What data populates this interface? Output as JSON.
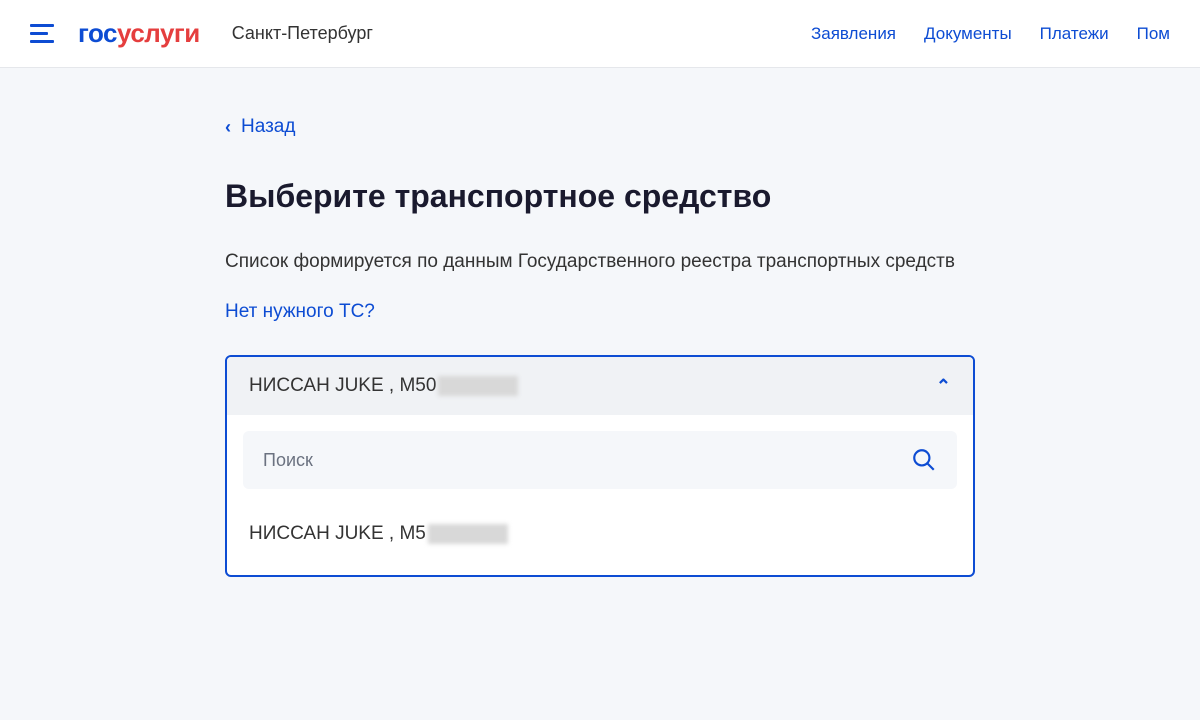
{
  "header": {
    "logo_part1": "гос",
    "logo_part2": "услуги",
    "city": "Санкт-Петербург",
    "nav": {
      "applications": "Заявления",
      "documents": "Документы",
      "payments": "Платежи",
      "help": "Пом"
    }
  },
  "content": {
    "back_label": "Назад",
    "title": "Выберите транспортное средство",
    "description": "Список формируется по данным Государственного реестра транспортных средств",
    "help_link": "Нет нужного ТС?"
  },
  "dropdown": {
    "selected_prefix": "НИССАН JUKE , M50",
    "search_placeholder": "Поиск",
    "option_prefix": "НИССАН JUKE , M5"
  }
}
